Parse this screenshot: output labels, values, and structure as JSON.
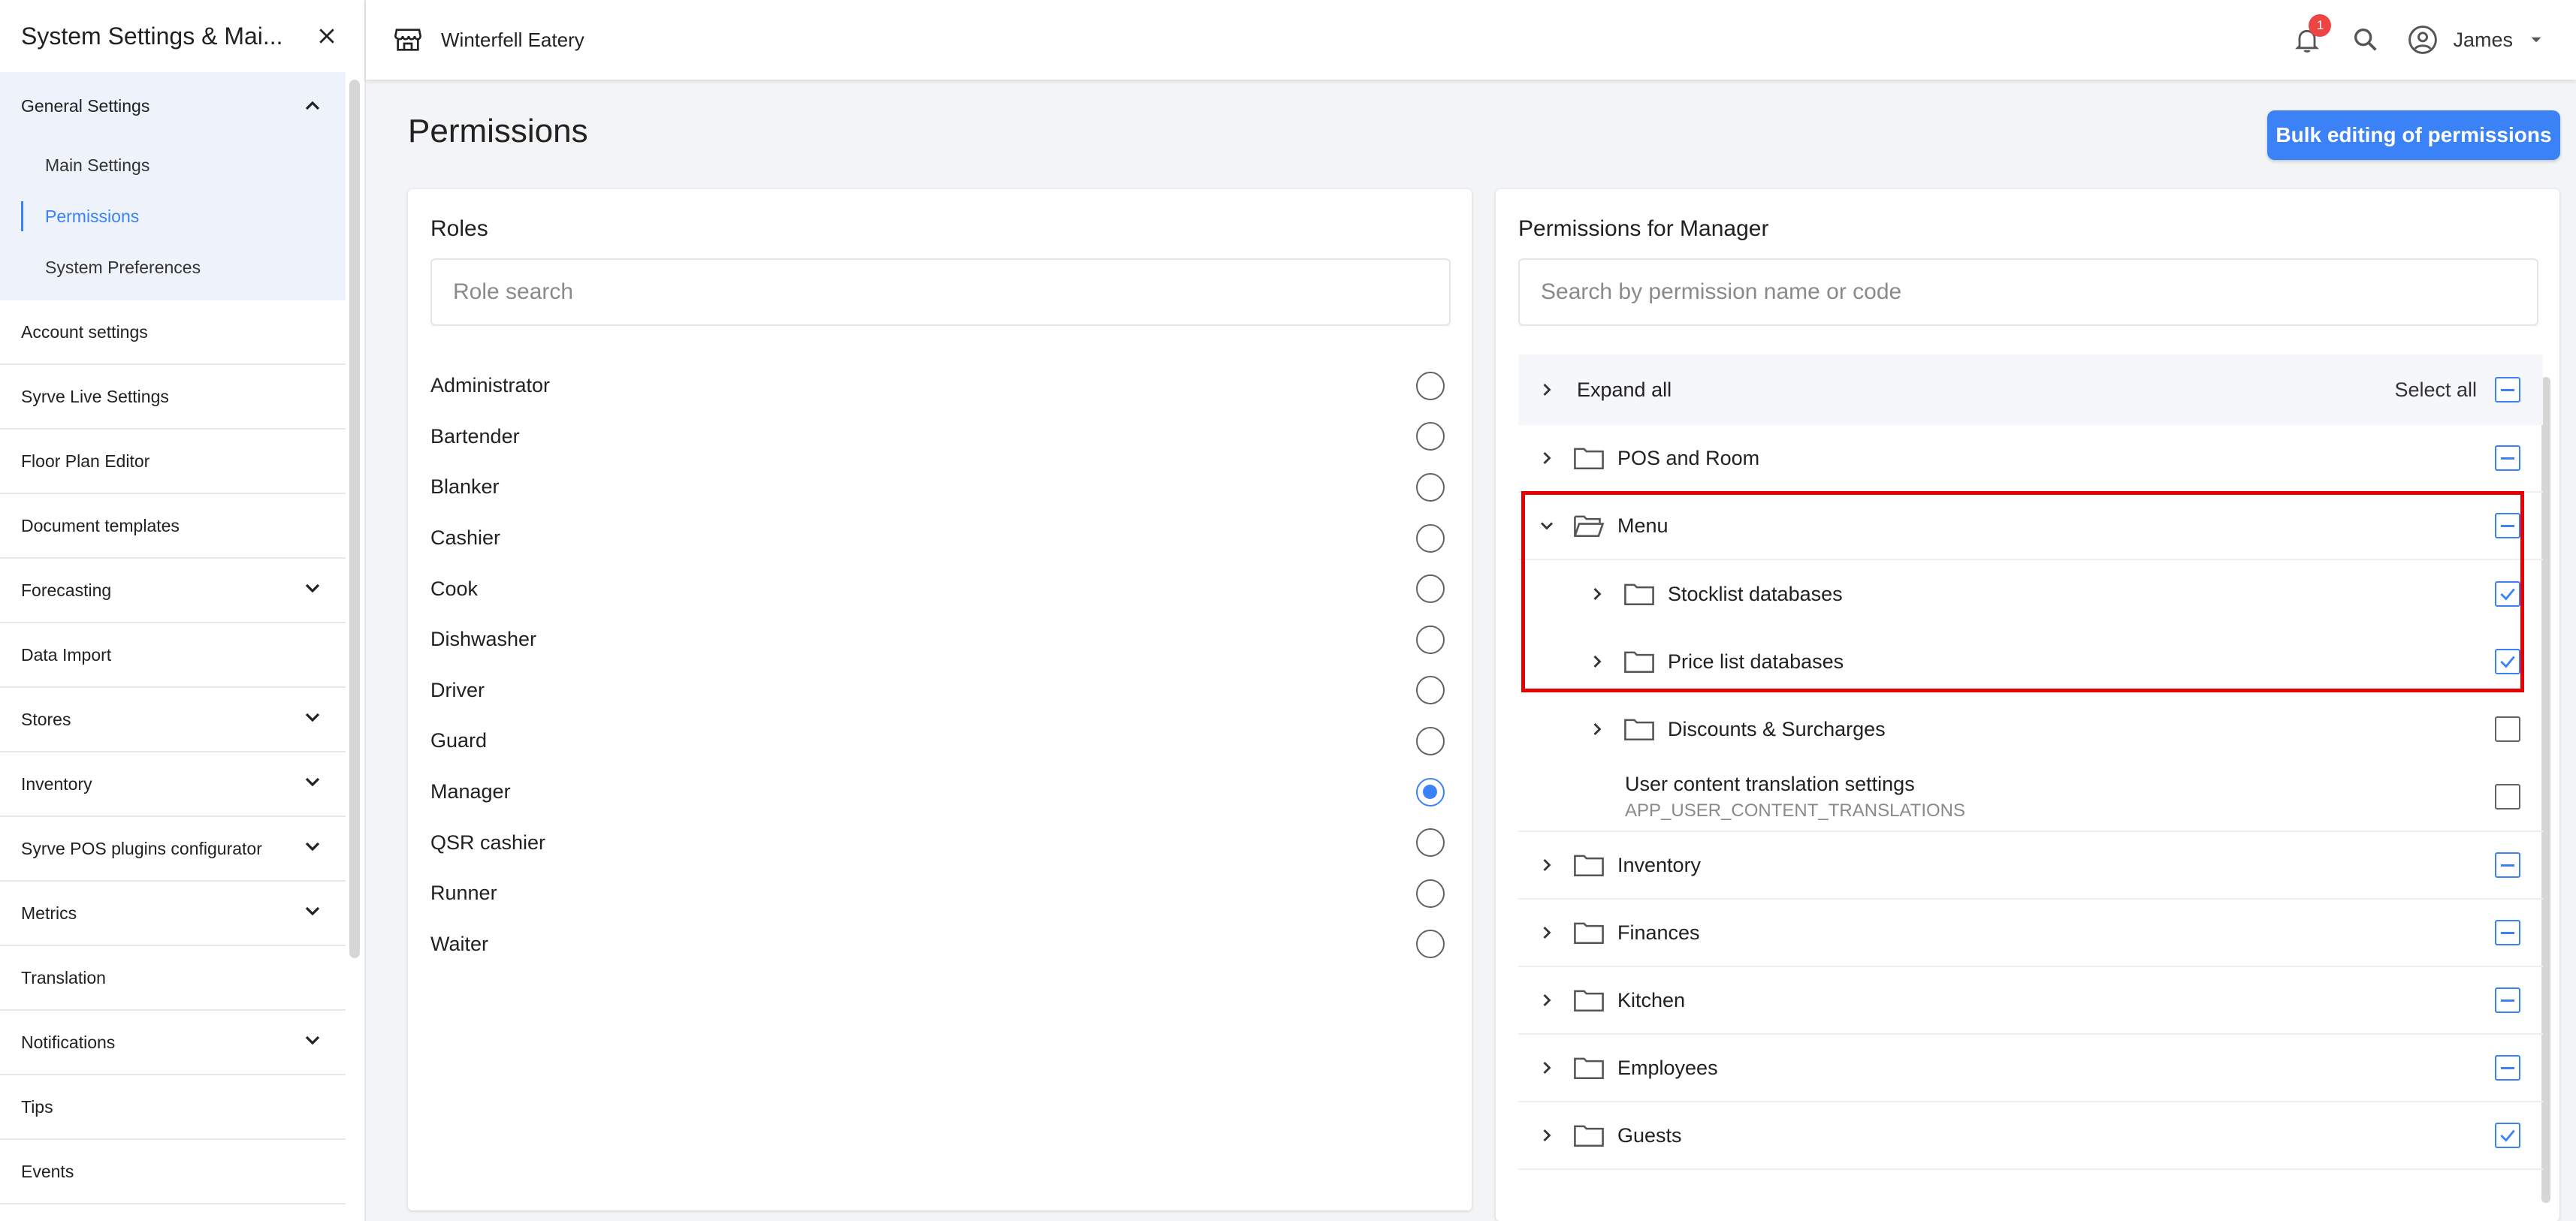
{
  "sidebar": {
    "title": "System Settings & Mai...",
    "general": {
      "label": "General Settings",
      "sub": [
        "Main Settings",
        "Permissions",
        "System Preferences"
      ]
    },
    "items": [
      {
        "label": "Account settings",
        "expandable": false
      },
      {
        "label": "Syrve Live Settings",
        "expandable": false
      },
      {
        "label": "Floor Plan Editor",
        "expandable": false
      },
      {
        "label": "Document templates",
        "expandable": false
      },
      {
        "label": "Forecasting",
        "expandable": true
      },
      {
        "label": "Data Import",
        "expandable": false
      },
      {
        "label": "Stores",
        "expandable": true
      },
      {
        "label": "Inventory",
        "expandable": true
      },
      {
        "label": "Syrve POS plugins configurator",
        "expandable": true
      },
      {
        "label": "Metrics",
        "expandable": true
      },
      {
        "label": "Translation",
        "expandable": false
      },
      {
        "label": "Notifications",
        "expandable": true
      },
      {
        "label": "Tips",
        "expandable": false
      },
      {
        "label": "Events",
        "expandable": false
      }
    ]
  },
  "topbar": {
    "store": "Winterfell Eatery",
    "notifications_count": "1",
    "user": "James"
  },
  "page": {
    "title": "Permissions",
    "bulk_button": "Bulk editing of permissions"
  },
  "roles": {
    "title": "Roles",
    "search_placeholder": "Role search",
    "items": [
      "Administrator",
      "Bartender",
      "Blanker",
      "Cashier",
      "Cook",
      "Dishwasher",
      "Driver",
      "Guard",
      "Manager",
      "QSR cashier",
      "Runner",
      "Waiter"
    ],
    "selected": "Manager"
  },
  "permissions": {
    "title": "Permissions for Manager",
    "search_placeholder": "Search by permission name or code",
    "expand_all": "Expand all",
    "select_all": "Select all",
    "groups": {
      "pos": "POS and Room",
      "menu": "Menu",
      "stocklist": "Stocklist databases",
      "pricelist": "Price list databases",
      "discounts": "Discounts & Surcharges",
      "translation": "User content translation settings",
      "translation_code": "APP_USER_CONTENT_TRANSLATIONS",
      "inventory": "Inventory",
      "finances": "Finances",
      "kitchen": "Kitchen",
      "employees": "Employees",
      "guests": "Guests"
    },
    "states": {
      "select_all": "indeterminate",
      "pos": "indeterminate",
      "menu": "indeterminate",
      "stocklist": "checked",
      "pricelist": "checked",
      "discounts": "unchecked",
      "translation": "unchecked",
      "inventory": "indeterminate",
      "finances": "indeterminate",
      "kitchen": "indeterminate",
      "employees": "indeterminate",
      "guests": "checked"
    }
  },
  "colors": {
    "accent": "#3b82f6",
    "highlight": "#e60000",
    "badge": "#ef4444"
  }
}
